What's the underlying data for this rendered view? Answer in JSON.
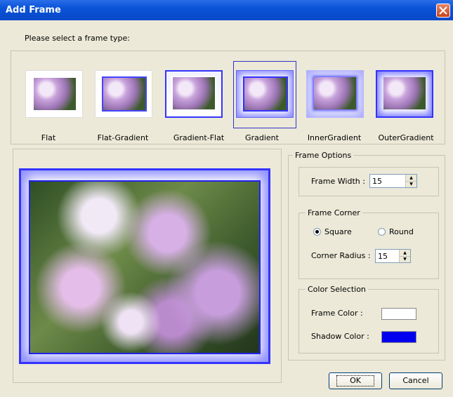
{
  "window": {
    "title": "Add Frame",
    "close_icon": "close-icon"
  },
  "prompt": "Please select a frame type:",
  "frame_types": [
    {
      "label": "Flat"
    },
    {
      "label": "Flat-Gradient"
    },
    {
      "label": "Gradient-Flat"
    },
    {
      "label": "Gradient",
      "selected": true
    },
    {
      "label": "InnerGradient"
    },
    {
      "label": "OuterGradient"
    }
  ],
  "frame_options": {
    "title": "Frame Options",
    "frame_width_label": "Frame Width :",
    "frame_width_value": "15"
  },
  "frame_corner": {
    "title": "Frame Corner",
    "square_label": "Square",
    "round_label": "Round",
    "selected": "Square",
    "corner_radius_label": "Corner Radius :",
    "corner_radius_value": "15"
  },
  "color_selection": {
    "title": "Color Selection",
    "frame_color_label": "Frame Color :",
    "frame_color": "#ffffff",
    "shadow_color_label": "Shadow Color :",
    "shadow_color": "#0000ee"
  },
  "buttons": {
    "ok": "OK",
    "cancel": "Cancel"
  },
  "colors": {
    "title_bar": "#0a53d8",
    "dialog_bg": "#ece9d8",
    "frame_blue": "#3333ff"
  }
}
